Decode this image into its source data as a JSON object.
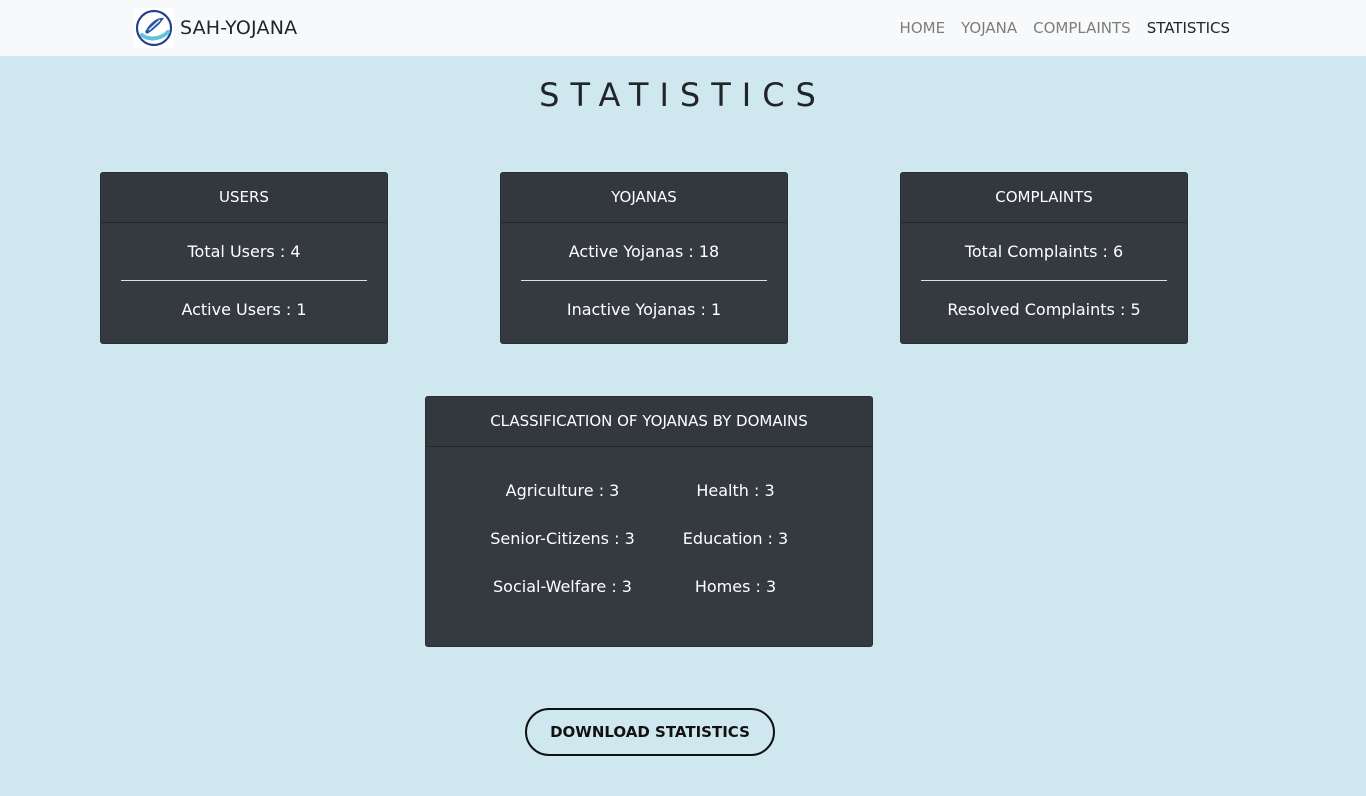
{
  "navbar": {
    "brand": "SAH-YOJANA",
    "links": [
      "HOME",
      "YOJANA",
      "COMPLAINTS",
      "STATISTICS"
    ],
    "active": "STATISTICS"
  },
  "page": {
    "title": "STATISTICS"
  },
  "cards": {
    "users": {
      "header": "USERS",
      "rows": [
        "Total Users : 4",
        "Active Users : 1"
      ]
    },
    "yojanas": {
      "header": "YOJANAS",
      "rows": [
        "Active Yojanas : 18",
        "Inactive Yojanas : 1"
      ]
    },
    "complaints": {
      "header": "COMPLAINTS",
      "rows": [
        "Total Complaints : 6",
        "Resolved Complaints : 5"
      ]
    }
  },
  "domains": {
    "header": "CLASSIFICATION OF YOJANAS BY DOMAINS",
    "items": [
      "Agriculture : 3",
      "Health : 3",
      "Senior-Citizens : 3",
      "Education : 3",
      "Social-Welfare : 3",
      "Homes : 3"
    ]
  },
  "download_label": "DOWNLOAD STATISTICS"
}
